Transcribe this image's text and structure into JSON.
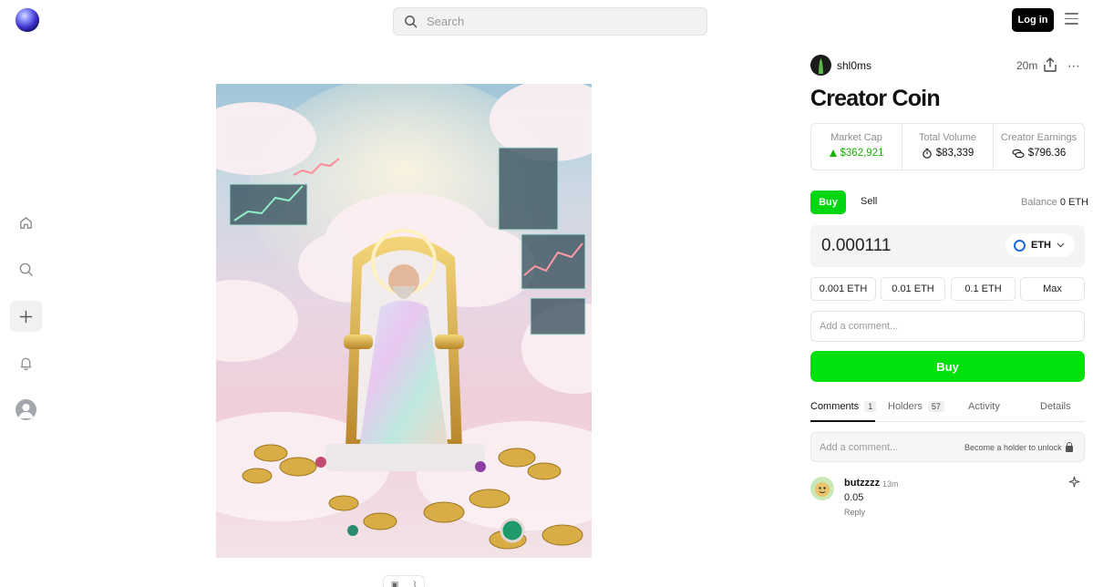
{
  "header": {
    "search_placeholder": "Search",
    "login_label": "Log in"
  },
  "nav": {
    "items": [
      "home-icon",
      "search-icon",
      "plus-icon",
      "bell-icon",
      "profile-icon"
    ]
  },
  "post": {
    "creator": "shl0ms",
    "time": "20m",
    "title": "Creator Coin"
  },
  "stats": {
    "market_cap_label": "Market Cap",
    "market_cap_value": "$362,921",
    "total_volume_label": "Total Volume",
    "total_volume_value": "$83,339",
    "creator_earnings_label": "Creator Earnings",
    "creator_earnings_value": "$796.36",
    "accent": "#16b300"
  },
  "trade": {
    "buy_tab": "Buy",
    "sell_tab": "Sell",
    "balance_label": "Balance",
    "balance_value": "0 ETH",
    "amount": "0.000111",
    "currency": "ETH",
    "presets": [
      "0.001 ETH",
      "0.01 ETH",
      "0.1 ETH",
      "Max"
    ],
    "comment_placeholder": "Add a comment...",
    "buy_button": "Buy",
    "buy_color": "#00e00a"
  },
  "tabs": {
    "comments_label": "Comments",
    "comments_count": "1",
    "holders_label": "Holders",
    "holders_count": "57",
    "activity_label": "Activity",
    "details_label": "Details"
  },
  "comments": {
    "input_placeholder": "Add a comment...",
    "unlock_text": "Become a holder to unlock",
    "items": [
      {
        "user": "butzzzz",
        "time": "13m",
        "text": "0.05",
        "reply": "Reply"
      }
    ]
  }
}
